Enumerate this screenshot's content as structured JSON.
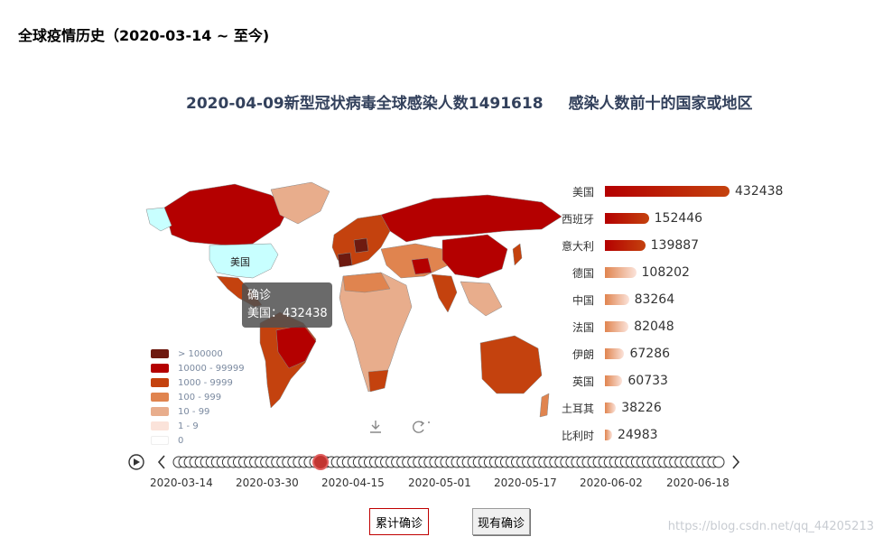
{
  "page": {
    "title": "全球疫情历史（2020-03-14 ~ 至今)"
  },
  "chart": {
    "title": "2020-04-09新型冠状病毒全球感染人数1491618",
    "subtitle": "感染人数前十的国家或地区",
    "map_label": "美国"
  },
  "legend": {
    "items": [
      {
        "label": "> 100000",
        "color": "#6e1a10"
      },
      {
        "label": "10000 - 99999",
        "color": "#b40000"
      },
      {
        "label": "1000 - 9999",
        "color": "#c4420e"
      },
      {
        "label": "100 - 999",
        "color": "#e0844f"
      },
      {
        "label": "10 - 99",
        "color": "#e8ad8c"
      },
      {
        "label": "1 - 9",
        "color": "#fbe3da"
      },
      {
        "label": "0",
        "color": "#ffffff"
      }
    ]
  },
  "tooltip": {
    "title": "确诊",
    "text": "美国：432438"
  },
  "chart_data": {
    "type": "bar",
    "title": "感染人数前十的国家或地区",
    "categories": [
      "美国",
      "西班牙",
      "意大利",
      "德国",
      "中国",
      "法国",
      "伊朗",
      "英国",
      "土耳其",
      "比利时"
    ],
    "values": [
      432438,
      152446,
      139887,
      108202,
      83264,
      82048,
      67286,
      60733,
      38226,
      24983
    ],
    "value_labels": [
      "432438",
      "152446",
      "139887",
      "108202",
      "83264",
      "82048",
      "67286",
      "60733",
      "38226",
      "24983"
    ]
  },
  "timeline": {
    "labels": [
      "2020-03-14",
      "2020-03-30",
      "2020-04-15",
      "2020-05-01",
      "2020-05-17",
      "2020-06-02",
      "2020-06-18"
    ],
    "current": "2020-04-09"
  },
  "buttons": {
    "total": "累计确诊",
    "current": "现有确诊"
  },
  "watermark": "https://blog.csdn.net/qq_44205213",
  "colors": {
    "accent": "#c00000",
    "title": "#33415c"
  }
}
